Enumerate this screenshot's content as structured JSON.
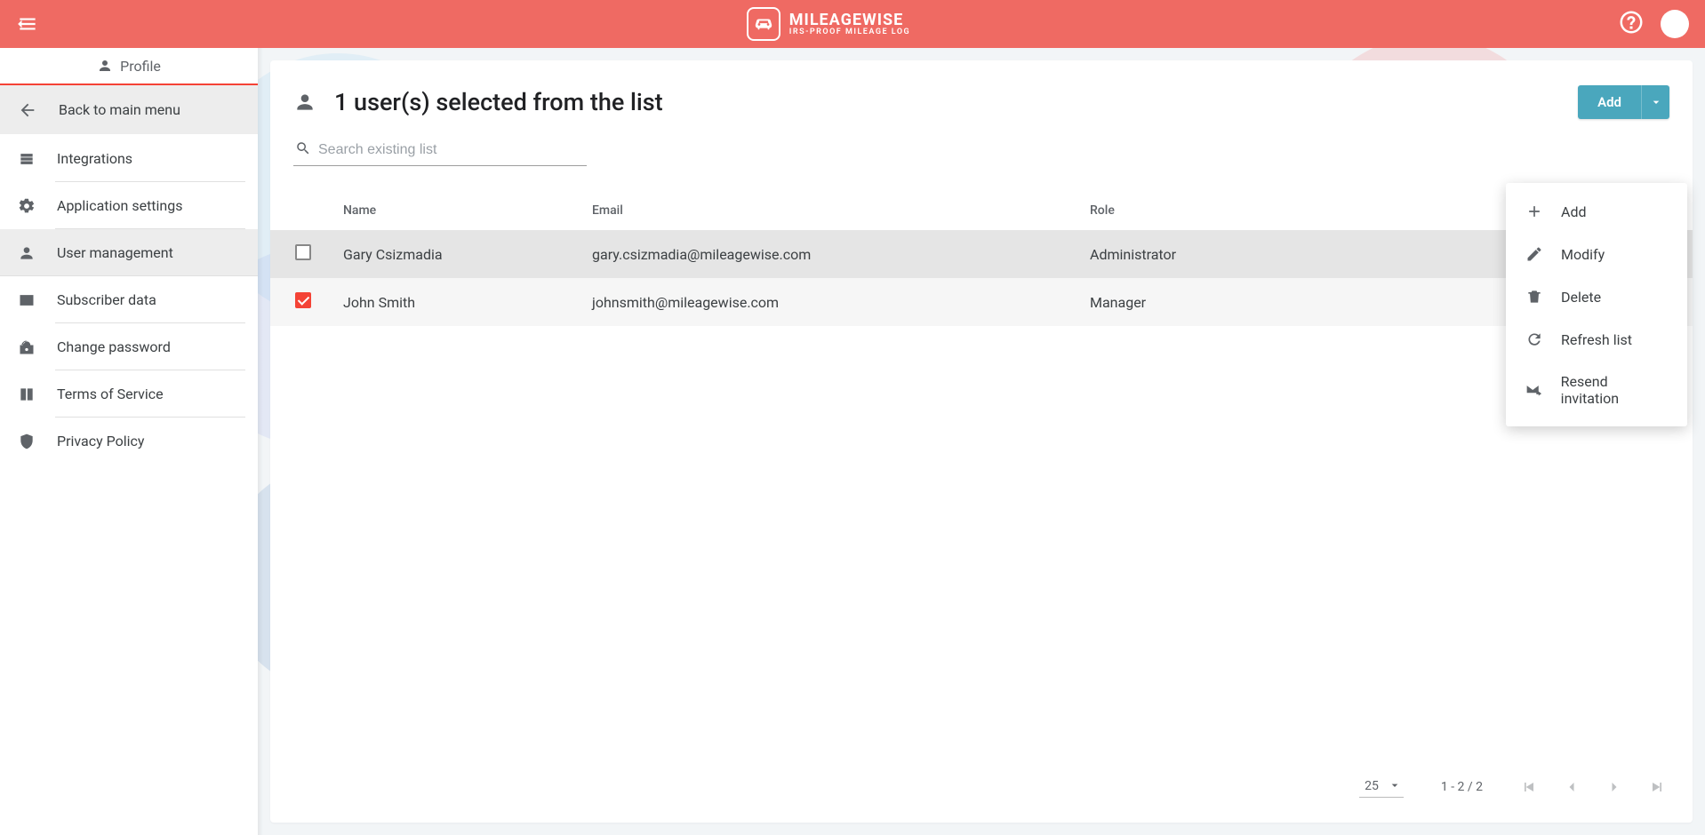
{
  "brand": {
    "name": "MILEAGEWISE",
    "tagline": "IRS-PROOF MILEAGE LOG"
  },
  "sidebar": {
    "header": "Profile",
    "back": "Back to main menu",
    "items": [
      {
        "label": "Integrations",
        "icon": "integrations"
      },
      {
        "label": "Application settings",
        "icon": "settings"
      },
      {
        "label": "User management",
        "icon": "user-management",
        "active": true
      },
      {
        "label": "Subscriber data",
        "icon": "subscriber"
      },
      {
        "label": "Change password",
        "icon": "password"
      },
      {
        "label": "Terms of Service",
        "icon": "terms"
      },
      {
        "label": "Privacy Policy",
        "icon": "privacy"
      }
    ]
  },
  "page": {
    "title": "1 user(s) selected from the list",
    "search_placeholder": "Search existing list",
    "add_button": "Add"
  },
  "table": {
    "columns": {
      "name": "Name",
      "email": "Email",
      "role": "Role"
    },
    "rows": [
      {
        "checked": false,
        "name": "Gary Csizmadia",
        "email": "gary.csizmadia@mileagewise.com",
        "role": "Administrator"
      },
      {
        "checked": true,
        "name": "John Smith",
        "email": "johnsmith@mileagewise.com",
        "role": "Manager"
      }
    ]
  },
  "pagination": {
    "page_size": "25",
    "range": "1 - 2 / 2"
  },
  "dropdown": {
    "items": [
      {
        "label": "Add",
        "icon": "plus"
      },
      {
        "label": "Modify",
        "icon": "pencil"
      },
      {
        "label": "Delete",
        "icon": "trash"
      },
      {
        "label": "Refresh list",
        "icon": "refresh"
      },
      {
        "label": "Resend invitation",
        "icon": "mail-forward"
      }
    ]
  }
}
